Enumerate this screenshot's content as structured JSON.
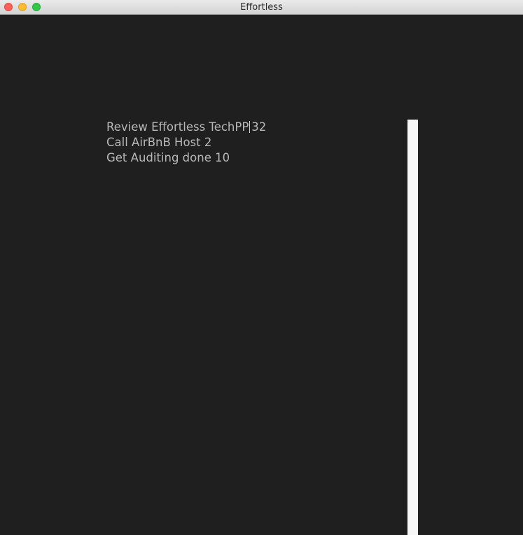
{
  "window": {
    "title": "Effortless"
  },
  "editor": {
    "tasks": [
      {
        "before_caret": "Review Effortless TechPP",
        "after_caret": "32"
      },
      {
        "text": "Call AirBnB Host 2"
      },
      {
        "text": "Get Auditing done 10"
      }
    ]
  },
  "colors": {
    "background": "#1f1f1f",
    "text": "#b8b8b8",
    "side_bar": "#f7f7f7"
  }
}
